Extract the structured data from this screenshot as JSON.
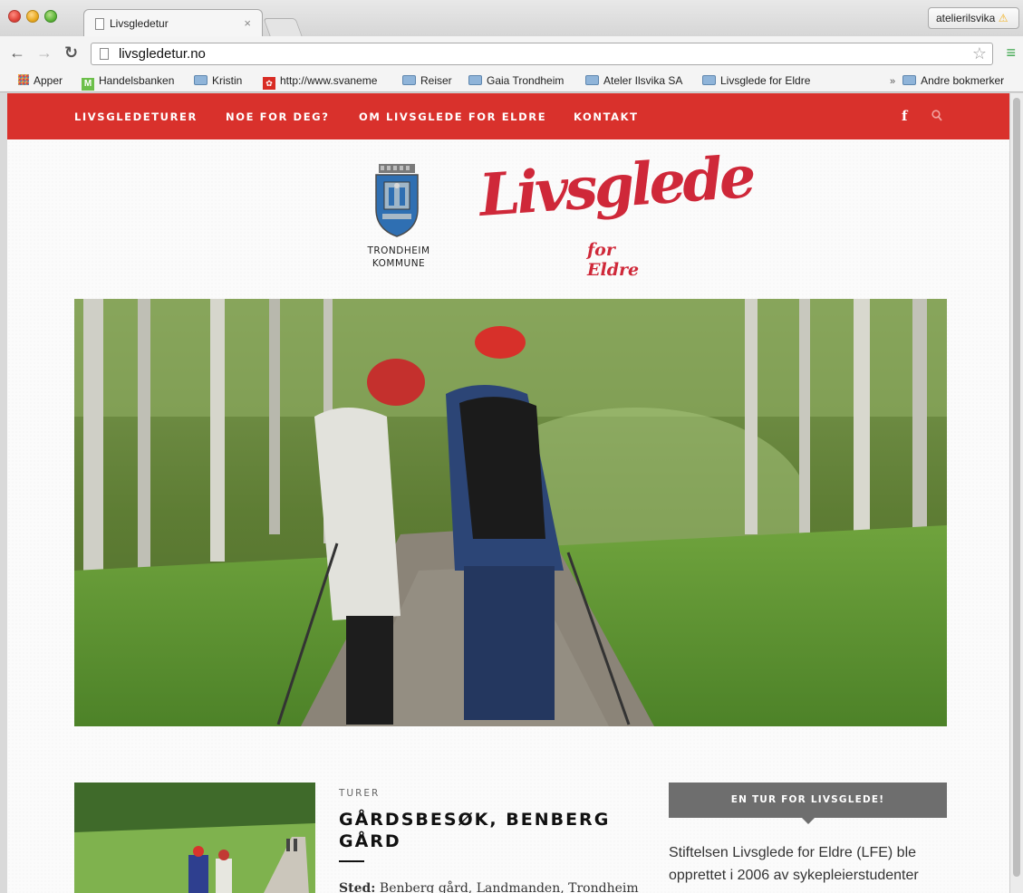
{
  "browser": {
    "tab_title": "Livsgledetur",
    "tab_close": "×",
    "profile": "atelierilsvika",
    "profile_warn": "⚠",
    "url": "livsgledetur.no",
    "bookmarks": [
      "Apper",
      "Handelsbanken",
      "Kristin",
      "http://www.svaneme",
      "Reiser",
      "Gaia Trondheim",
      "Ateler Ilsvika SA",
      "Livsglede for Eldre"
    ],
    "more_bookmarks": "»",
    "other_bookmarks": "Andre bokmerker"
  },
  "site": {
    "nav": [
      "LIVSGLEDETURER",
      "NOE FOR DEG?",
      "OM LIVSGLEDE FOR ELDRE",
      "KONTAKT"
    ],
    "fb_glyph": "f",
    "crest_line1": "TRONDHEIM",
    "crest_line2": "KOMMUNE",
    "brand_script": "Livsglede",
    "brand_sub": "for Eldre",
    "accent": "#d9312c"
  },
  "post": {
    "category": "TURER",
    "title_line1": "GÅRDSBESØK, BENBERG",
    "title_line2": "GÅRD",
    "meta_label": "Sted:",
    "meta_value": " Benberg gård, Landmanden, Trondheim"
  },
  "sidebar": {
    "widget_title": "EN TUR FOR LIVSGLEDE!",
    "widget_line1": "Stiftelsen Livsglede for Eldre (LFE) ble",
    "widget_line2": "opprettet i 2006 av sykepleierstudenter"
  }
}
